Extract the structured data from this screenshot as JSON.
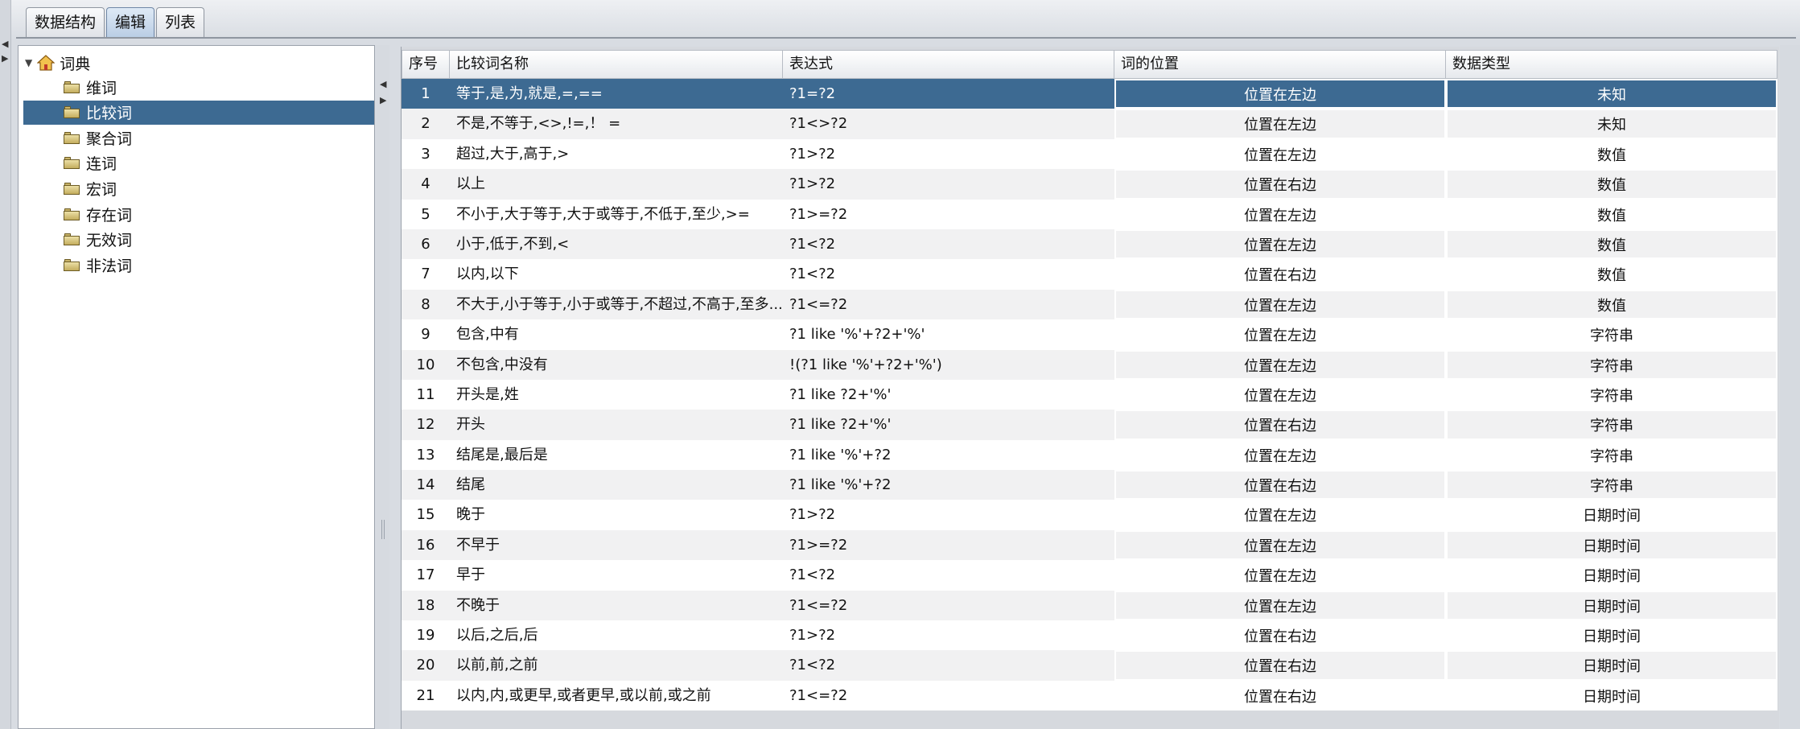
{
  "tabs": [
    {
      "label": "数据结构",
      "active": false
    },
    {
      "label": "编辑",
      "active": true
    },
    {
      "label": "列表",
      "active": false
    }
  ],
  "tree": {
    "root_label": "词典",
    "items": [
      {
        "label": "维词",
        "selected": false
      },
      {
        "label": "比较词",
        "selected": true
      },
      {
        "label": "聚合词",
        "selected": false
      },
      {
        "label": "连词",
        "selected": false
      },
      {
        "label": "宏词",
        "selected": false
      },
      {
        "label": "存在词",
        "selected": false
      },
      {
        "label": "无效词",
        "selected": false
      },
      {
        "label": "非法词",
        "selected": false
      }
    ]
  },
  "table": {
    "headers": [
      "序号",
      "比较词名称",
      "表达式",
      "词的位置",
      "数据类型"
    ],
    "rows": [
      [
        "1",
        "等于,是,为,就是,=,==",
        "?1=?2",
        "位置在左边",
        "未知"
      ],
      [
        "2",
        "不是,不等于,<>,!=,！ =",
        "?1<>?2",
        "位置在左边",
        "未知"
      ],
      [
        "3",
        "超过,大于,高于,>",
        "?1>?2",
        "位置在左边",
        "数值"
      ],
      [
        "4",
        "以上",
        "?1>?2",
        "位置在右边",
        "数值"
      ],
      [
        "5",
        "不小于,大于等于,大于或等于,不低于,至少,>=",
        "?1>=?2",
        "位置在左边",
        "数值"
      ],
      [
        "6",
        "小于,低于,不到,<",
        "?1<?2",
        "位置在左边",
        "数值"
      ],
      [
        "7",
        "以内,以下",
        "?1<?2",
        "位置在右边",
        "数值"
      ],
      [
        "8",
        "不大于,小于等于,小于或等于,不超过,不高于,至多...",
        "?1<=?2",
        "位置在左边",
        "数值"
      ],
      [
        "9",
        "包含,中有",
        "?1 like '%'+?2+'%'",
        "位置在左边",
        "字符串"
      ],
      [
        "10",
        "不包含,中没有",
        "!(?1 like '%'+?2+'%')",
        "位置在左边",
        "字符串"
      ],
      [
        "11",
        "开头是,姓",
        "?1 like ?2+'%'",
        "位置在左边",
        "字符串"
      ],
      [
        "12",
        "开头",
        "?1 like ?2+'%'",
        "位置在右边",
        "字符串"
      ],
      [
        "13",
        "结尾是,最后是",
        "?1 like '%'+?2",
        "位置在左边",
        "字符串"
      ],
      [
        "14",
        "结尾",
        "?1 like '%'+?2",
        "位置在右边",
        "字符串"
      ],
      [
        "15",
        "晚于",
        "?1>?2",
        "位置在左边",
        "日期时间"
      ],
      [
        "16",
        "不早于",
        "?1>=?2",
        "位置在左边",
        "日期时间"
      ],
      [
        "17",
        "早于",
        "?1<?2",
        "位置在左边",
        "日期时间"
      ],
      [
        "18",
        "不晚于",
        "?1<=?2",
        "位置在左边",
        "日期时间"
      ],
      [
        "19",
        "以后,之后,后",
        "?1>?2",
        "位置在右边",
        "日期时间"
      ],
      [
        "20",
        "以前,前,之前",
        "?1<?2",
        "位置在右边",
        "日期时间"
      ],
      [
        "21",
        "以内,内,或更早,或者更早,或以前,或之前",
        "?1<=?2",
        "位置在右边",
        "日期时间"
      ]
    ],
    "selected_row": 0
  }
}
